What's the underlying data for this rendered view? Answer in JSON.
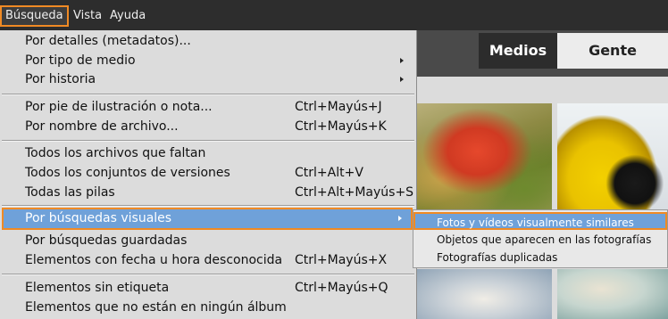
{
  "menubar": {
    "items": [
      {
        "label": "Búsqueda"
      },
      {
        "label": "Vista"
      },
      {
        "label": "Ayuda"
      }
    ]
  },
  "tabs": [
    {
      "label": "Medios"
    },
    {
      "label": "Gente"
    }
  ],
  "menu": {
    "items": [
      {
        "label": "Por detalles (metadatos)...",
        "shortcut": ""
      },
      {
        "label": "Por tipo de medio",
        "shortcut": ""
      },
      {
        "label": "Por historia",
        "shortcut": ""
      },
      {
        "label": "Por pie de ilustración o nota...",
        "shortcut": "Ctrl+Mayús+J"
      },
      {
        "label": "Por nombre de archivo...",
        "shortcut": "Ctrl+Mayús+K"
      },
      {
        "label": "Todos los archivos que faltan",
        "shortcut": ""
      },
      {
        "label": "Todos los conjuntos de versiones",
        "shortcut": "Ctrl+Alt+V"
      },
      {
        "label": "Todas las pilas",
        "shortcut": "Ctrl+Alt+Mayús+S"
      },
      {
        "label": "Por búsquedas visuales",
        "shortcut": ""
      },
      {
        "label": "Por búsquedas guardadas",
        "shortcut": ""
      },
      {
        "label": "Elementos con fecha u hora desconocida",
        "shortcut": "Ctrl+Mayús+X"
      },
      {
        "label": "Elementos sin etiqueta",
        "shortcut": "Ctrl+Mayús+Q"
      },
      {
        "label": "Elementos que no están en ningún álbum",
        "shortcut": ""
      }
    ]
  },
  "submenu": {
    "items": [
      {
        "label": "Fotos y vídeos visualmente similares"
      },
      {
        "label": "Objetos que aparecen en las fotografías"
      },
      {
        "label": "Fotografías duplicadas"
      }
    ]
  },
  "colors": {
    "highlight": "#6fa1d9",
    "callout": "#f08a24",
    "menu_bg": "#dcdcdc",
    "menubar_bg": "#2d2d2d"
  }
}
